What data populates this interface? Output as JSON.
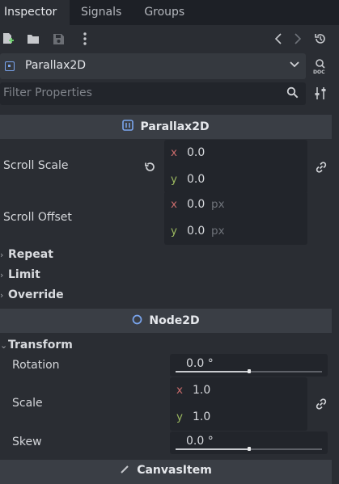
{
  "tabs": [
    {
      "label": "Inspector",
      "active": true
    },
    {
      "label": "Signals",
      "active": false
    },
    {
      "label": "Groups",
      "active": false
    }
  ],
  "toolbar": {
    "icons": [
      "new-resource-icon",
      "open-folder-icon",
      "save-icon",
      "more-vert-icon",
      "history-back-icon",
      "history-forward-icon",
      "history-icon",
      "doc-search-icon"
    ]
  },
  "node_selector": {
    "label": "Parallax2D",
    "icon": "parallax2d-node-icon"
  },
  "filter": {
    "placeholder": "Filter Properties"
  },
  "sections": {
    "parallax": {
      "title": "Parallax2D",
      "scroll_scale": {
        "label": "Scroll Scale",
        "x_axis": "x",
        "y_axis": "y",
        "x": "0.0",
        "y": "0.0"
      },
      "scroll_offset": {
        "label": "Scroll Offset",
        "x_axis": "x",
        "y_axis": "y",
        "x": "0.0",
        "y": "0.0",
        "unit": "px"
      },
      "groups": [
        "Repeat",
        "Limit",
        "Override"
      ]
    },
    "node2d": {
      "title": "Node2D",
      "transform_group": "Transform",
      "rotation": {
        "label": "Rotation",
        "value": "0.0 °",
        "slider_fraction": 0.5
      },
      "scale": {
        "label": "Scale",
        "x_axis": "x",
        "y_axis": "y",
        "x": "1.0",
        "y": "1.0"
      },
      "skew": {
        "label": "Skew",
        "value": "0.0 °",
        "slider_fraction": 0.5
      }
    },
    "canvas_item": {
      "title": "CanvasItem"
    }
  },
  "colors": {
    "x_axis": "#c96b6b",
    "y_axis": "#9bb85f",
    "accent": "#7aa5ee"
  }
}
